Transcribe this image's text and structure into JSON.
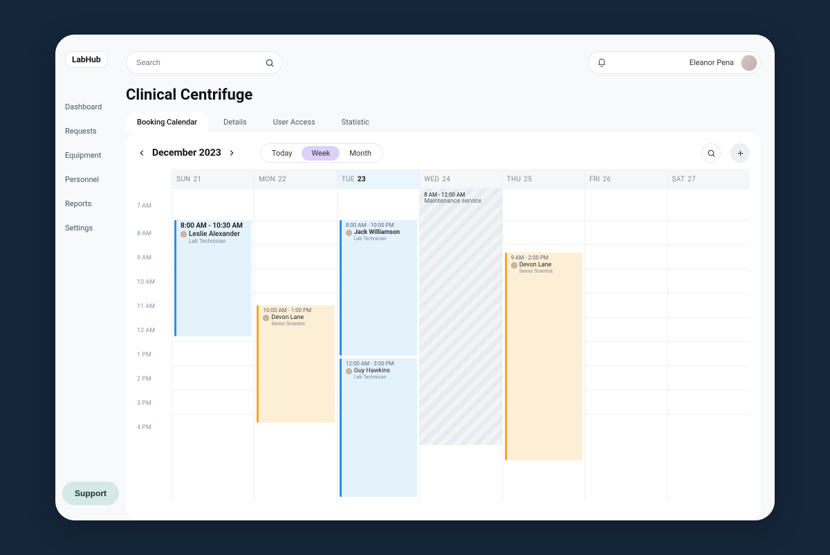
{
  "logo": "LabHub",
  "search_placeholder": "Search",
  "user_name": "Eleanor Pena",
  "page_title": "Clinical Centrifuge",
  "nav": [
    "Dashboard",
    "Requests",
    "Equipment",
    "Personnel",
    "Reports",
    "Settings"
  ],
  "support_label": "Support",
  "tabs": [
    "Booking Calendar",
    "Details",
    "User Access",
    "Statistic"
  ],
  "active_tab": 0,
  "month_label": "December 2023",
  "range": {
    "today": "Today",
    "week": "Week",
    "month": "Month",
    "active": "week"
  },
  "days": [
    {
      "dow": "SUN",
      "num": "21",
      "today": false
    },
    {
      "dow": "MON",
      "num": "22",
      "today": false
    },
    {
      "dow": "TUE",
      "num": "23",
      "today": true
    },
    {
      "dow": "WED",
      "num": "24",
      "today": false
    },
    {
      "dow": "THU",
      "num": "25",
      "today": false
    },
    {
      "dow": "FRI",
      "num": "26",
      "today": false
    },
    {
      "dow": "SAT",
      "num": "27",
      "today": false
    }
  ],
  "time_rows": [
    "7 AM",
    "8 AM",
    "9 AM",
    "10 AM",
    "11 AM",
    "12 AM",
    "1 PM",
    "2 PM",
    "3 PM",
    "4 PM"
  ],
  "events": {
    "sun_leslie": {
      "time": "8:00 AM  - 10:30 AM",
      "name": "Leslie Alexander",
      "role": "Lab Technician"
    },
    "mon_devon": {
      "time": "10:00 AM - 1:00 PM",
      "name": "Devon Lane",
      "role": "Senior Scientist"
    },
    "tue_jack": {
      "time": "8:00 AM - 10:00 PM",
      "name": "Jack Williamson",
      "role": "Lab Technician"
    },
    "tue_guy": {
      "time": "12:00 AM - 3:00 PM",
      "name": "Guy Hawkins",
      "role": "Lab Technician"
    },
    "wed_maint": {
      "time": "8 AM  - 12:00 AM",
      "name": "Maintenance service"
    },
    "thu_devon": {
      "time": "9 AM  - 2:00 PM",
      "name": "Devon Lane",
      "role": "Senior Scientist"
    }
  }
}
